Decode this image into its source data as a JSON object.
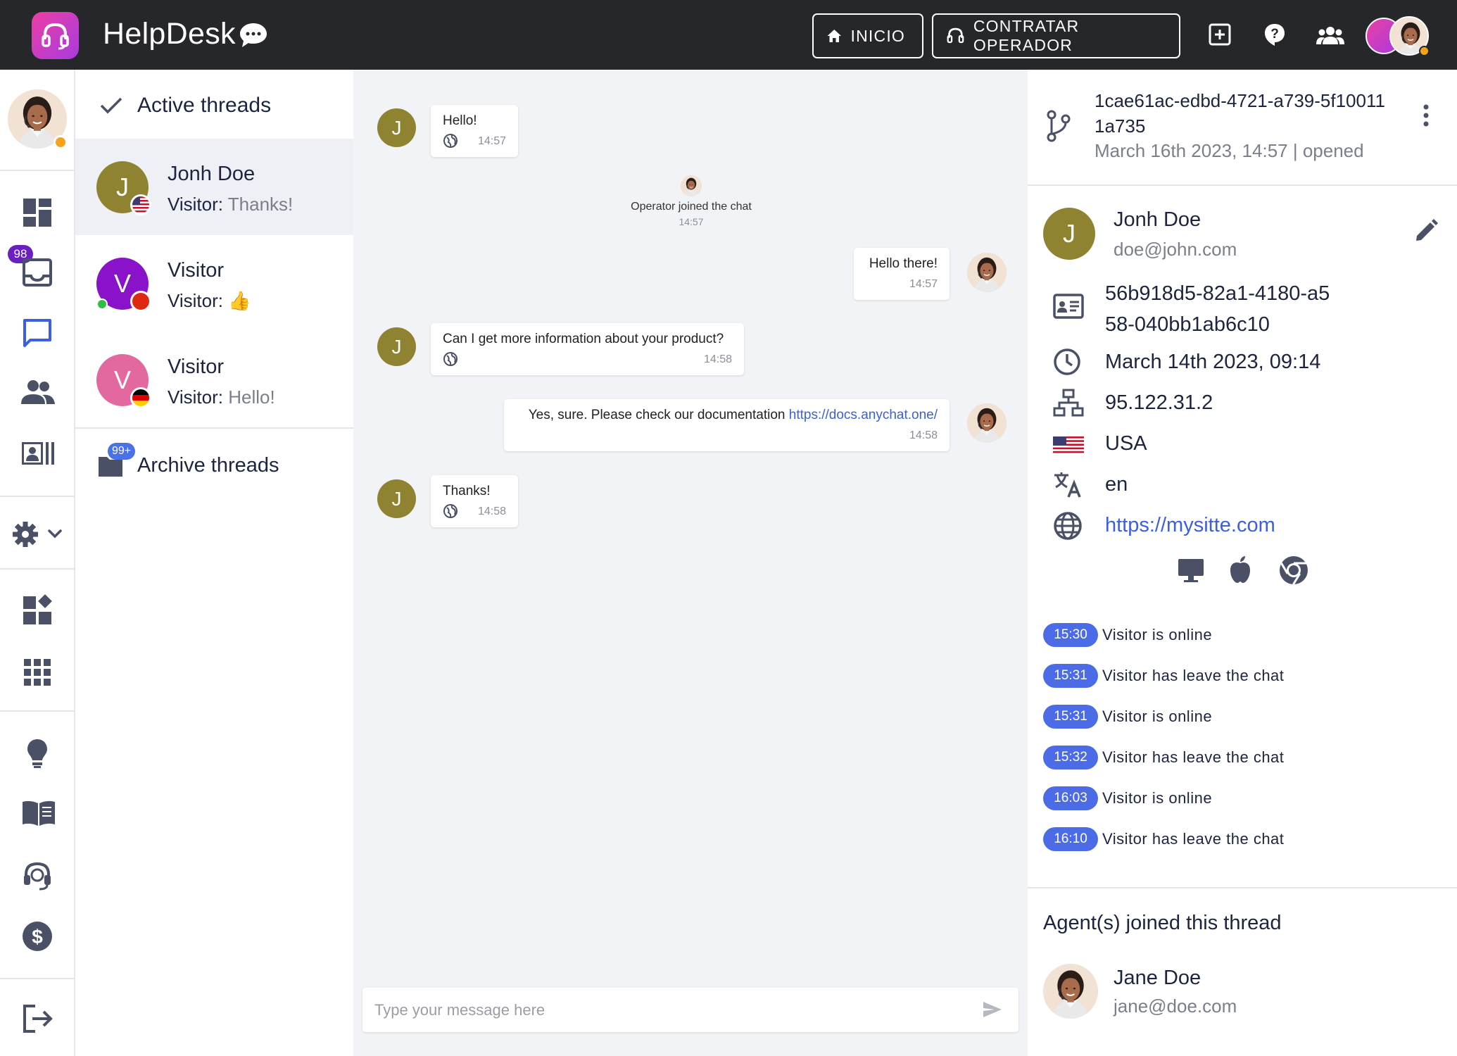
{
  "app": {
    "brand": "HelpDesk",
    "nav_home": "INICIO",
    "nav_hire": "CONTRATAR OPERADOR",
    "accent": "#4c6be6",
    "logo_gradient": [
      "#ec3fa4",
      "#a73be0"
    ]
  },
  "rail": {
    "inbox_badge": "98",
    "items": [
      "dashboard-icon",
      "inbox-icon",
      "chat-icon",
      "people-icon",
      "contacts-icon",
      "settings-icon",
      "widgets-icon",
      "apps-icon",
      "bulb-icon",
      "book-icon",
      "support-icon",
      "billing-icon",
      "logout-icon"
    ]
  },
  "threads": {
    "active_title": "Active threads",
    "items": [
      {
        "initial": "J",
        "name": "Jonh Doe",
        "prefix": "Visitor",
        "sep": ": ",
        "message": "Thanks!",
        "color": "#8f8231",
        "flag": "USA"
      },
      {
        "initial": "V",
        "name": "Visitor",
        "prefix": "Visitor",
        "sep": ": ",
        "message": "👍",
        "color": "#8a12c9",
        "flag": "China",
        "online": true
      },
      {
        "initial": "V",
        "name": "Visitor",
        "prefix": "Visitor",
        "sep": ": ",
        "message": "Hello!",
        "color": "#e3689f",
        "flag": "Germany"
      }
    ],
    "archive_label": "Archive threads",
    "archive_badge": "99+"
  },
  "chat": {
    "messages": [
      {
        "from": "visitor",
        "initial": "J",
        "text": "Hello!",
        "time": "14:57"
      },
      {
        "from": "operator",
        "text": "Hello there!",
        "time": "14:57"
      },
      {
        "from": "visitor",
        "initial": "J",
        "text": "Can I get more information about your product?",
        "time": "14:58"
      },
      {
        "from": "operator",
        "text": "Yes, sure. Please check our documentation ",
        "link": "https://docs.anychat.one/",
        "time": "14:58"
      },
      {
        "from": "visitor",
        "initial": "J",
        "text": "Thanks!",
        "time": "14:58"
      }
    ],
    "system": {
      "text": "Operator joined the chat",
      "time": "14:57"
    },
    "composer_placeholder": "Type your message here"
  },
  "panel": {
    "thread_id": "1cae61ac-edbd-4721-a739-5f100111a735",
    "thread_date": "March 16th 2023, 14:57 | opened",
    "visitor": {
      "initial": "J",
      "name": "Jonh Doe",
      "email": "doe@john.com"
    },
    "visitor_id": "56b918d5-82a1-4180-a558-040bb1ab6c10",
    "first_seen": "March 14th 2023, 09:14",
    "ip": "95.122.31.2",
    "country": "USA",
    "language": "en",
    "website": "https://mysitte.com",
    "devices": [
      "desktop-icon",
      "apple-icon",
      "chrome-icon"
    ],
    "events": [
      {
        "time": "15:30",
        "label": "Visitor is online"
      },
      {
        "time": "15:31",
        "label": "Visitor has leave the chat"
      },
      {
        "time": "15:31",
        "label": "Visitor is online"
      },
      {
        "time": "15:32",
        "label": "Visitor has leave the chat"
      },
      {
        "time": "16:03",
        "label": "Visitor is online"
      },
      {
        "time": "16:10",
        "label": "Visitor has leave the chat"
      }
    ],
    "agents_title": "Agent(s) joined this thread",
    "agent": {
      "name": "Jane Doe",
      "email": "jane@doe.com"
    }
  }
}
